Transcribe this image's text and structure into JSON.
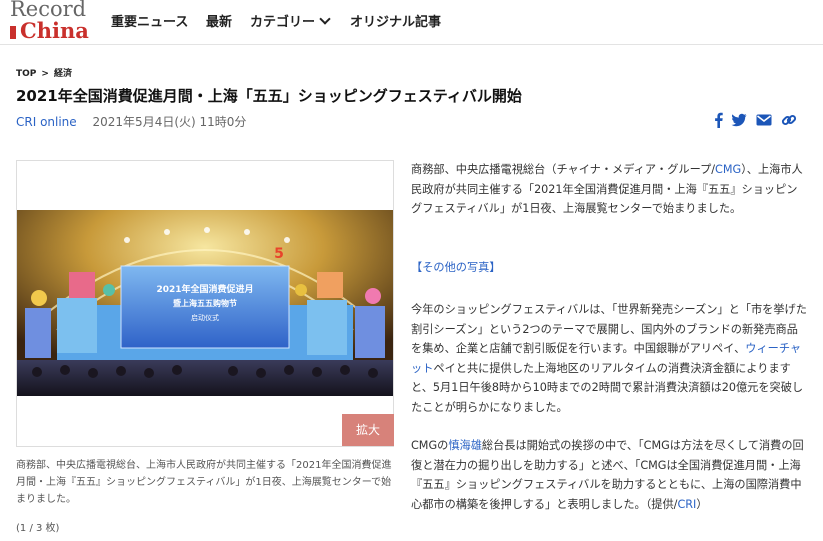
{
  "site": {
    "logo_line1": "Record",
    "logo_line2": "China",
    "accent_color": "#c9302c",
    "link_color": "#2b63c5"
  },
  "nav": {
    "items": [
      {
        "label": "重要ニュース"
      },
      {
        "label": "最新"
      },
      {
        "label": "カテゴリー",
        "icon": "chevron-down-icon"
      },
      {
        "label": "オリジナル記事"
      }
    ]
  },
  "breadcrumb": {
    "items": [
      "TOP",
      "経済"
    ],
    "separator": ">"
  },
  "article": {
    "title": "2021年全国消費促進月間・上海「五五」ショッピングフェスティバル開始",
    "source": "CRI online",
    "date": "2021年5月4日(火) 11時0分",
    "share_icons": [
      "facebook-icon",
      "twitter-icon",
      "mail-icon",
      "link-icon"
    ],
    "p1": {
      "before": "商務部、中央広播電視総台（チャイナ・メディア・グループ/",
      "link": "CMG",
      "after": "）、上海市人民政府が共同主催する「2021年全国消費促進月間・上海『五五』ショッピングフェスティバル」が1日夜、上海展覧センターで始まりました。"
    },
    "more_photos": "【その他の写真】",
    "p3": {
      "before": "今年のショッピングフェスティバルは、「世界新発売シーズン」と「市を挙げた割引シーズン」という2つのテーマで展開し、国内外のブランドの新発売商品を集め、企業と店舗で割引販促を行います。中国銀聯がアリペイ、",
      "link": "ウィーチャット",
      "after": "ペイと共に提供した上海地区のリアルタイムの消費決済金額によりますと、5月1日午後8時から10時までの2時間で累計消費決済額は20億元を突破したことが明らかになりました。"
    },
    "p4": {
      "a": "CMGの",
      "link": "慎海雄",
      "b": "総台長は開始式の挨拶の中で、「CMGは方法を尽くして消費の回復と潜在力の掘り出しを助力する」と述べ、「CMGは全国消費促進月間・上海『五五』ショッピングフェスティバルを助力するとともに、上海の国際消費中心都市の構築を後押しする」と表明しました。（提供/",
      "link2": "CRI",
      "c": "）"
    }
  },
  "photo": {
    "zoom_label": "拡大",
    "stage_text_line1": "2021年全国消费促进月",
    "stage_text_line2": "暨上海五五购物节",
    "stage_text_line3": "启动仪式",
    "caption": "商務部、中央広播電視総台、上海市人民政府が共同主催する「2021年全国消費促進月間・上海『五五』ショッピングフェスティバル」が1日夜、上海展覧センターで始まりました。",
    "counter": "(1 / 3 枚)"
  }
}
